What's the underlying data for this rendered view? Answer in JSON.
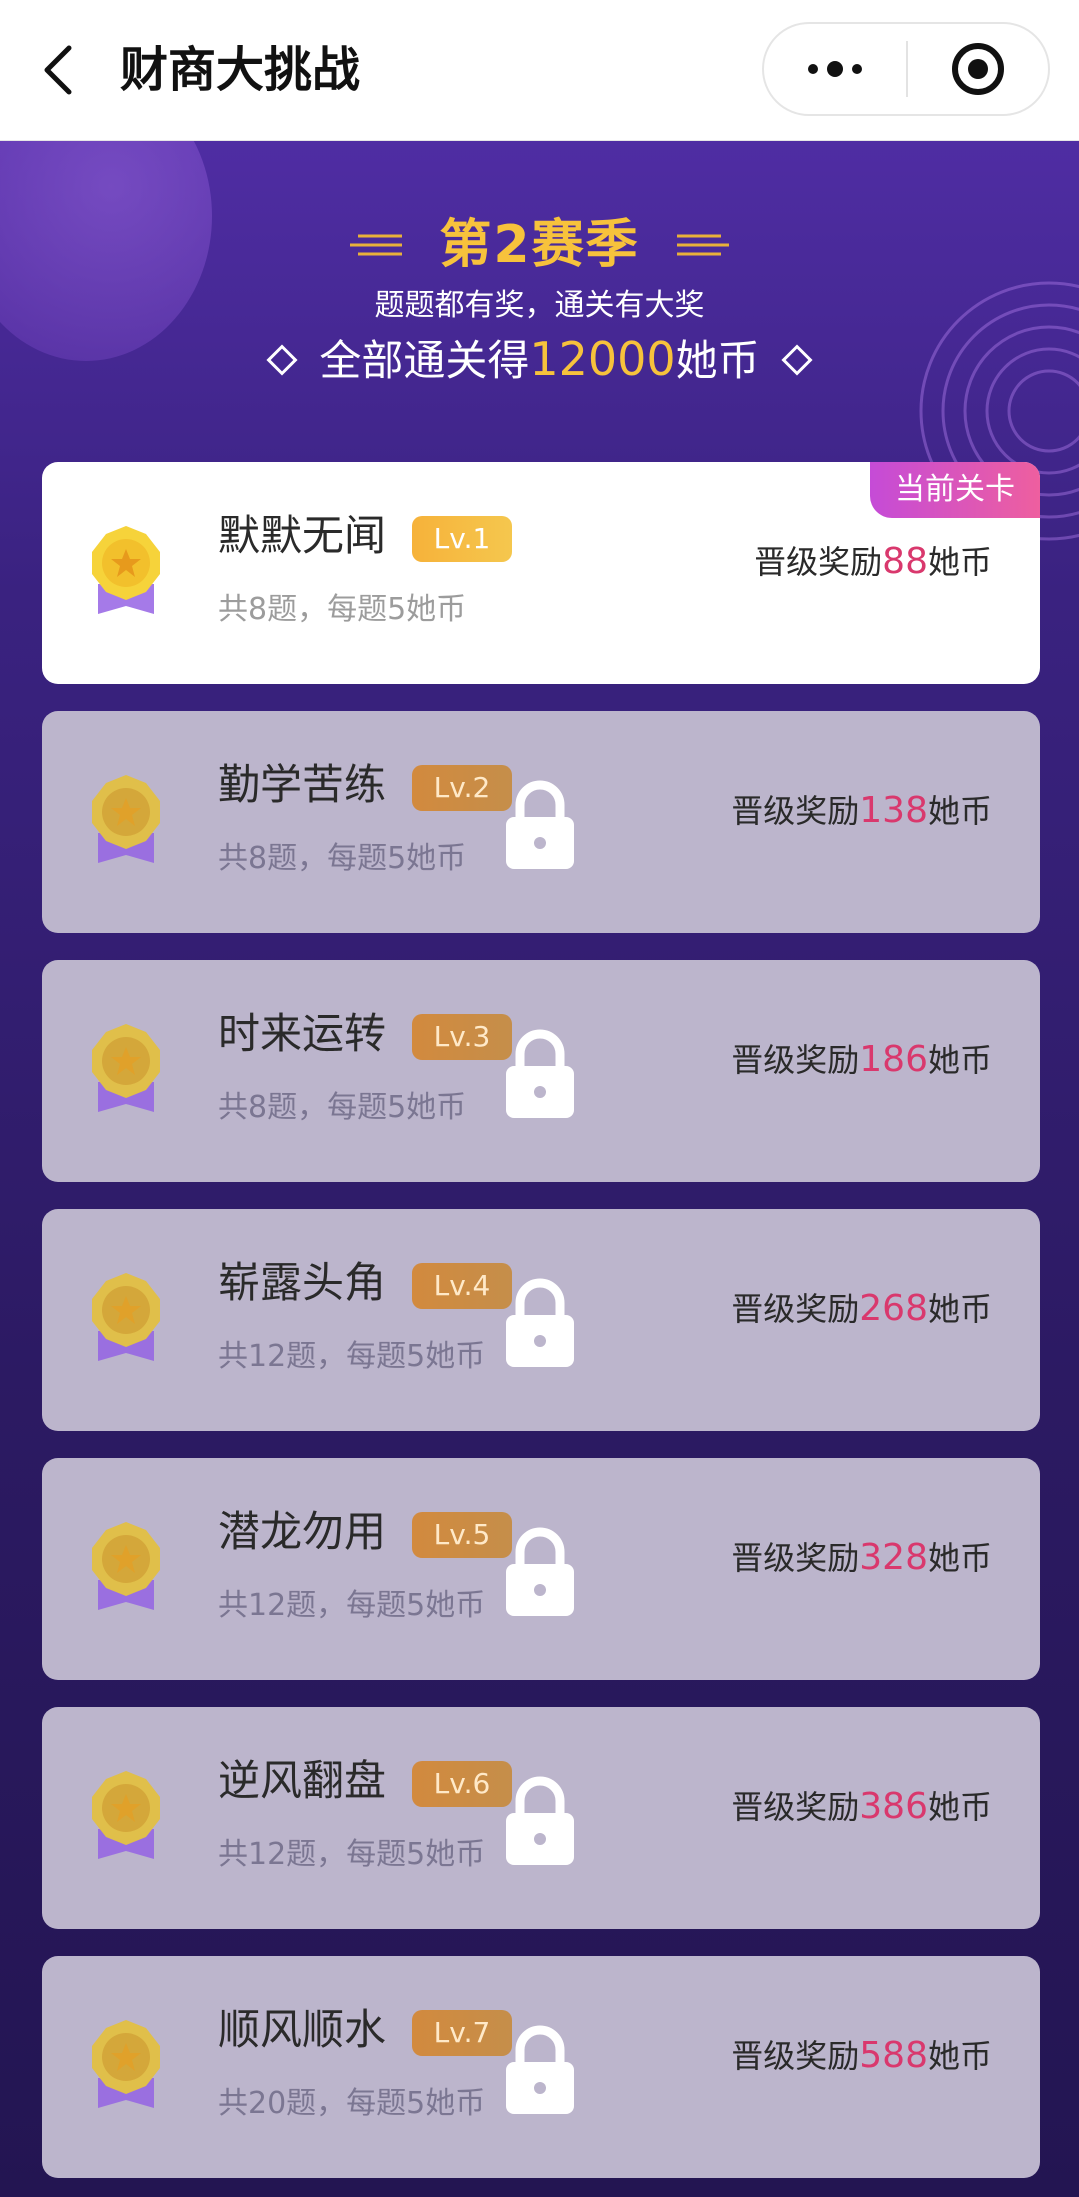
{
  "header": {
    "title": "财商大挑战",
    "icons": {
      "back": "chevron-left-icon",
      "more": "more-dots-icon",
      "close": "target-circle-icon"
    }
  },
  "hero": {
    "season_title": "第2赛季",
    "subtitle": "题题都有奖，通关有大奖",
    "grand_prefix": "全部通关得",
    "grand_amount": "12000",
    "grand_suffix": "她币"
  },
  "colors": {
    "accent_gold": "#f7c23c",
    "reward_pink": "#d9386d",
    "tag_gradient_start": "#c54bd7",
    "tag_gradient_end": "#ee5f9f",
    "background_purple": "#3a2280",
    "locked_card": "#bcb5cc"
  },
  "current_tag": "当前关卡",
  "reward_prefix": "晋级奖励",
  "reward_suffix": "她币",
  "levels": [
    {
      "name": "默默无闻",
      "level": "Lv.1",
      "info": "共8题，每题5她币",
      "reward": "88",
      "locked": false,
      "current": true
    },
    {
      "name": "勤学苦练",
      "level": "Lv.2",
      "info": "共8题，每题5她币",
      "reward": "138",
      "locked": true,
      "current": false
    },
    {
      "name": "时来运转",
      "level": "Lv.3",
      "info": "共8题，每题5她币",
      "reward": "186",
      "locked": true,
      "current": false
    },
    {
      "name": "崭露头角",
      "level": "Lv.4",
      "info": "共12题，每题5她币",
      "reward": "268",
      "locked": true,
      "current": false
    },
    {
      "name": "潜龙勿用",
      "level": "Lv.5",
      "info": "共12题，每题5她币",
      "reward": "328",
      "locked": true,
      "current": false
    },
    {
      "name": "逆风翻盘",
      "level": "Lv.6",
      "info": "共12题，每题5她币",
      "reward": "386",
      "locked": true,
      "current": false
    },
    {
      "name": "顺风顺水",
      "level": "Lv.7",
      "info": "共20题，每题5她币",
      "reward": "588",
      "locked": true,
      "current": false
    }
  ]
}
